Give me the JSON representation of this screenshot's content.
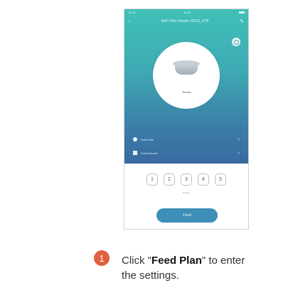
{
  "status_bar": {
    "time": "16:40",
    "clock": "09:41"
  },
  "nav": {
    "back": "‹",
    "title": "WiFi Pet Feeder-35CE_2T8",
    "edit": "✎"
  },
  "bowl": {
    "name": "Standa"
  },
  "menu": [
    {
      "label": "Feed Plan",
      "chevron": "›"
    },
    {
      "label": "Feed Record",
      "chevron": "›"
    }
  ],
  "portions": [
    "1",
    "2",
    "3",
    "4",
    "5"
  ],
  "portion_label": "Portion",
  "feed_button": "Feed",
  "instruction": {
    "step": "1",
    "prefix": "Click \"",
    "bold": "Feed Plan",
    "suffix": "\" to enter",
    "line2": "the settings."
  }
}
